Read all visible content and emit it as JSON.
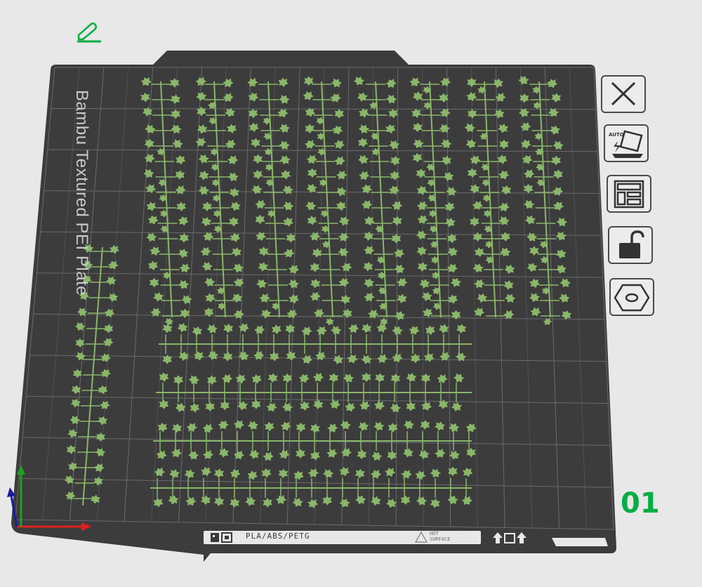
{
  "plate": {
    "label": "Bambu Textured PEI Plate",
    "number": "01",
    "number_color": "#00ae42",
    "filaments": "PLA/ABS/PETG",
    "hot_surface": [
      "HOT",
      "SURFACE"
    ]
  },
  "colors": {
    "background": "#e8e8e8",
    "plate": "#3c3c3c",
    "grid": "#6a6a6a",
    "model": "#8ab66a",
    "accent": "#00ae42",
    "axis_x": "#e02020",
    "axis_y": "#20a020",
    "axis_z": "#1a1aa0"
  },
  "toolbar": {
    "edit": {
      "icon": "pencil-edit-icon"
    },
    "buttons": [
      {
        "id": "remove-plate",
        "icon": "close-x-icon"
      },
      {
        "id": "auto-orient",
        "icon": "auto-orient-icon",
        "label": "AUTO"
      },
      {
        "id": "arrange",
        "icon": "arrange-layout-icon"
      },
      {
        "id": "lock-plate",
        "icon": "unlock-icon"
      },
      {
        "id": "plate-settings",
        "icon": "hexagon-nut-icon"
      }
    ]
  },
  "models": {
    "vertical_columns": 9,
    "horizontal_rows": 4,
    "description_icon": "plant-sprig-model"
  }
}
